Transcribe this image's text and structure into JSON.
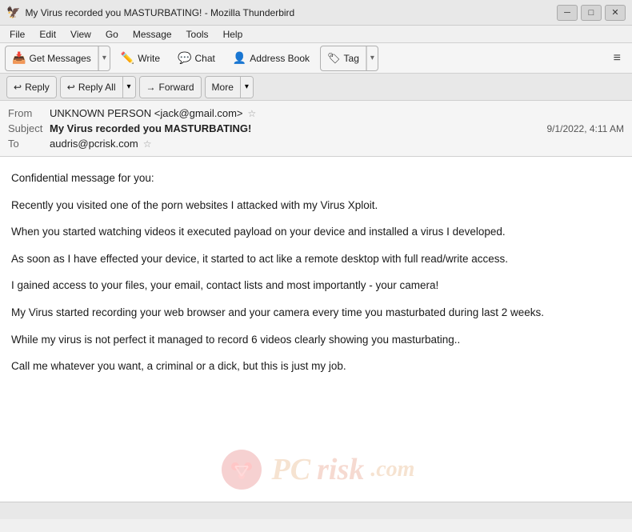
{
  "window": {
    "title": "My Virus recorded you MASTURBATING! - Mozilla Thunderbird",
    "icon": "🦅"
  },
  "titlebar": {
    "minimize_label": "─",
    "maximize_label": "□",
    "close_label": "✕"
  },
  "menu": {
    "items": [
      "File",
      "Edit",
      "View",
      "Go",
      "Message",
      "Tools",
      "Help"
    ]
  },
  "toolbar": {
    "get_messages_label": "Get Messages",
    "write_label": "Write",
    "chat_label": "Chat",
    "address_book_label": "Address Book",
    "tag_label": "Tag",
    "hamburger": "≡"
  },
  "action_bar": {
    "reply_label": "Reply",
    "reply_all_label": "Reply All",
    "forward_label": "Forward",
    "more_label": "More"
  },
  "email": {
    "from_label": "From",
    "from_name": "UNKNOWN PERSON",
    "from_email": "<jack@gmail.com>",
    "subject_label": "Subject",
    "subject": "My Virus recorded you MASTURBATING!",
    "to_label": "To",
    "to_email": "audris@pcrisk.com",
    "date": "9/1/2022, 4:11 AM",
    "body_paragraphs": [
      "Confidential message for you:",
      "Recently you visited one of the porn websites I attacked with my Virus Xploit.",
      "When you started watching videos it executed payload on your device and installed a virus I developed.",
      "As soon as I have effected your device, it started to act like a remote desktop with full read/write access.",
      "I gained access to your files, your email, contact lists and most importantly - your camera!",
      "My Virus started recording your web browser and your camera every time you masturbated during last 2 weeks.",
      "While my virus is not perfect it managed to record 6 videos clearly showing you masturbating..",
      "Call me whatever you want, a criminal or a dick, but this is just my job."
    ]
  },
  "watermark": {
    "site": "pcrisk.com"
  },
  "status_bar": {
    "text": ""
  }
}
